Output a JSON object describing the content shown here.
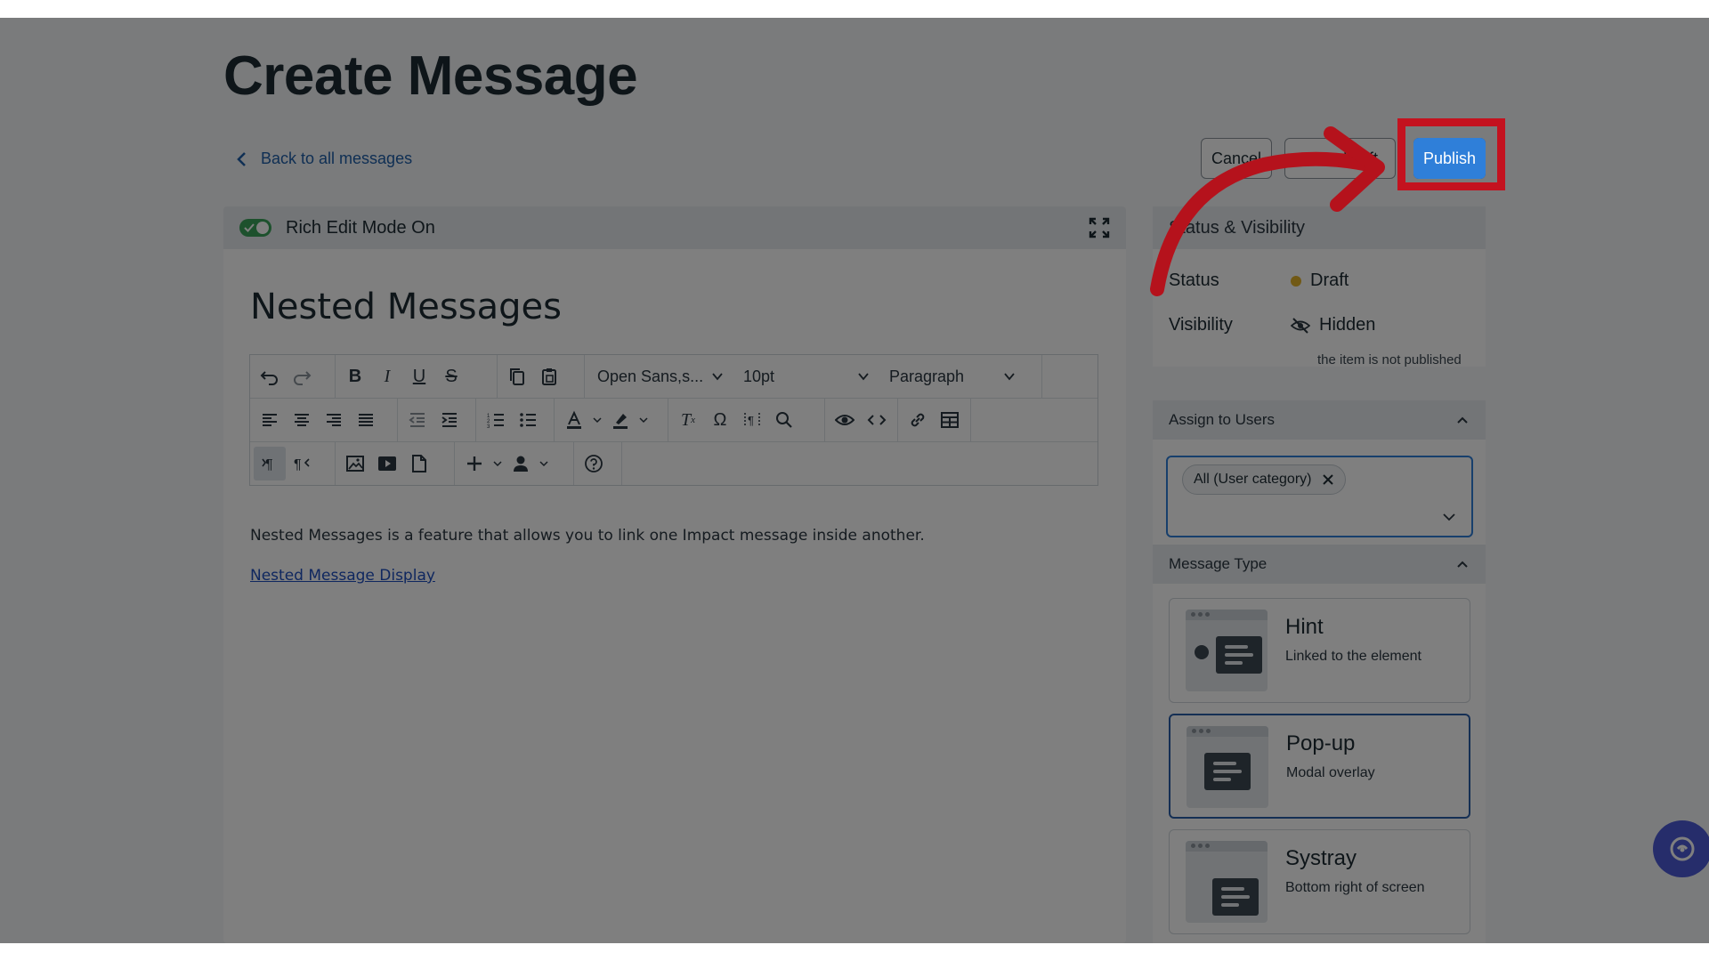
{
  "page": {
    "title": "Create Message",
    "back_label": "Back to all messages"
  },
  "actions": {
    "cancel_label": "Cancel",
    "draft_label": "Save Draft",
    "publish_label": "Publish"
  },
  "editor": {
    "mode_label": "Rich Edit Mode On",
    "doc_title": "Nested Messages",
    "font_family": "Open Sans,s...",
    "font_size": "10pt",
    "block_format": "Paragraph",
    "body_text": "Nested Messages is a feature that allows you to link one Impact message inside another.",
    "link_text": "Nested Message Display",
    "toolbar_icons": [
      "undo-icon",
      "redo-icon",
      "bold-icon",
      "italic-icon",
      "underline-icon",
      "strikethrough-icon",
      "copy-icon",
      "paste-icon",
      "align-left-icon",
      "align-center-icon",
      "align-right-icon",
      "align-justify-icon",
      "outdent-icon",
      "indent-icon",
      "numbered-list-icon",
      "bullet-list-icon",
      "text-color-icon",
      "highlight-color-icon",
      "clear-formatting-icon",
      "special-character-icon",
      "nonbreaking-icon",
      "search-replace-icon",
      "preview-icon",
      "source-code-icon",
      "link-icon",
      "table-icon",
      "ltr-icon",
      "rtl-icon",
      "image-icon",
      "video-icon",
      "template-icon",
      "insert-icon",
      "personalize-icon",
      "help-icon"
    ]
  },
  "status_visibility": {
    "heading": "Status & Visibility",
    "status_label": "Status",
    "status_value": "Draft",
    "visibility_label": "Visibility",
    "visibility_value": "Hidden",
    "visibility_note": "the item is not published"
  },
  "assign": {
    "heading": "Assign to Users",
    "chip_label": "All (User category)"
  },
  "message_type": {
    "heading": "Message Type",
    "options": [
      {
        "name": "Hint",
        "description": "Linked to the element",
        "selected": false
      },
      {
        "name": "Pop-up",
        "description": "Modal overlay",
        "selected": true
      },
      {
        "name": "Systray",
        "description": "Bottom right of screen",
        "selected": false
      }
    ]
  },
  "colors": {
    "accent": "#2f7fd9",
    "highlight": "#c4121f",
    "toggle_on": "#3aa35b",
    "draft_dot": "#e2b22a"
  }
}
